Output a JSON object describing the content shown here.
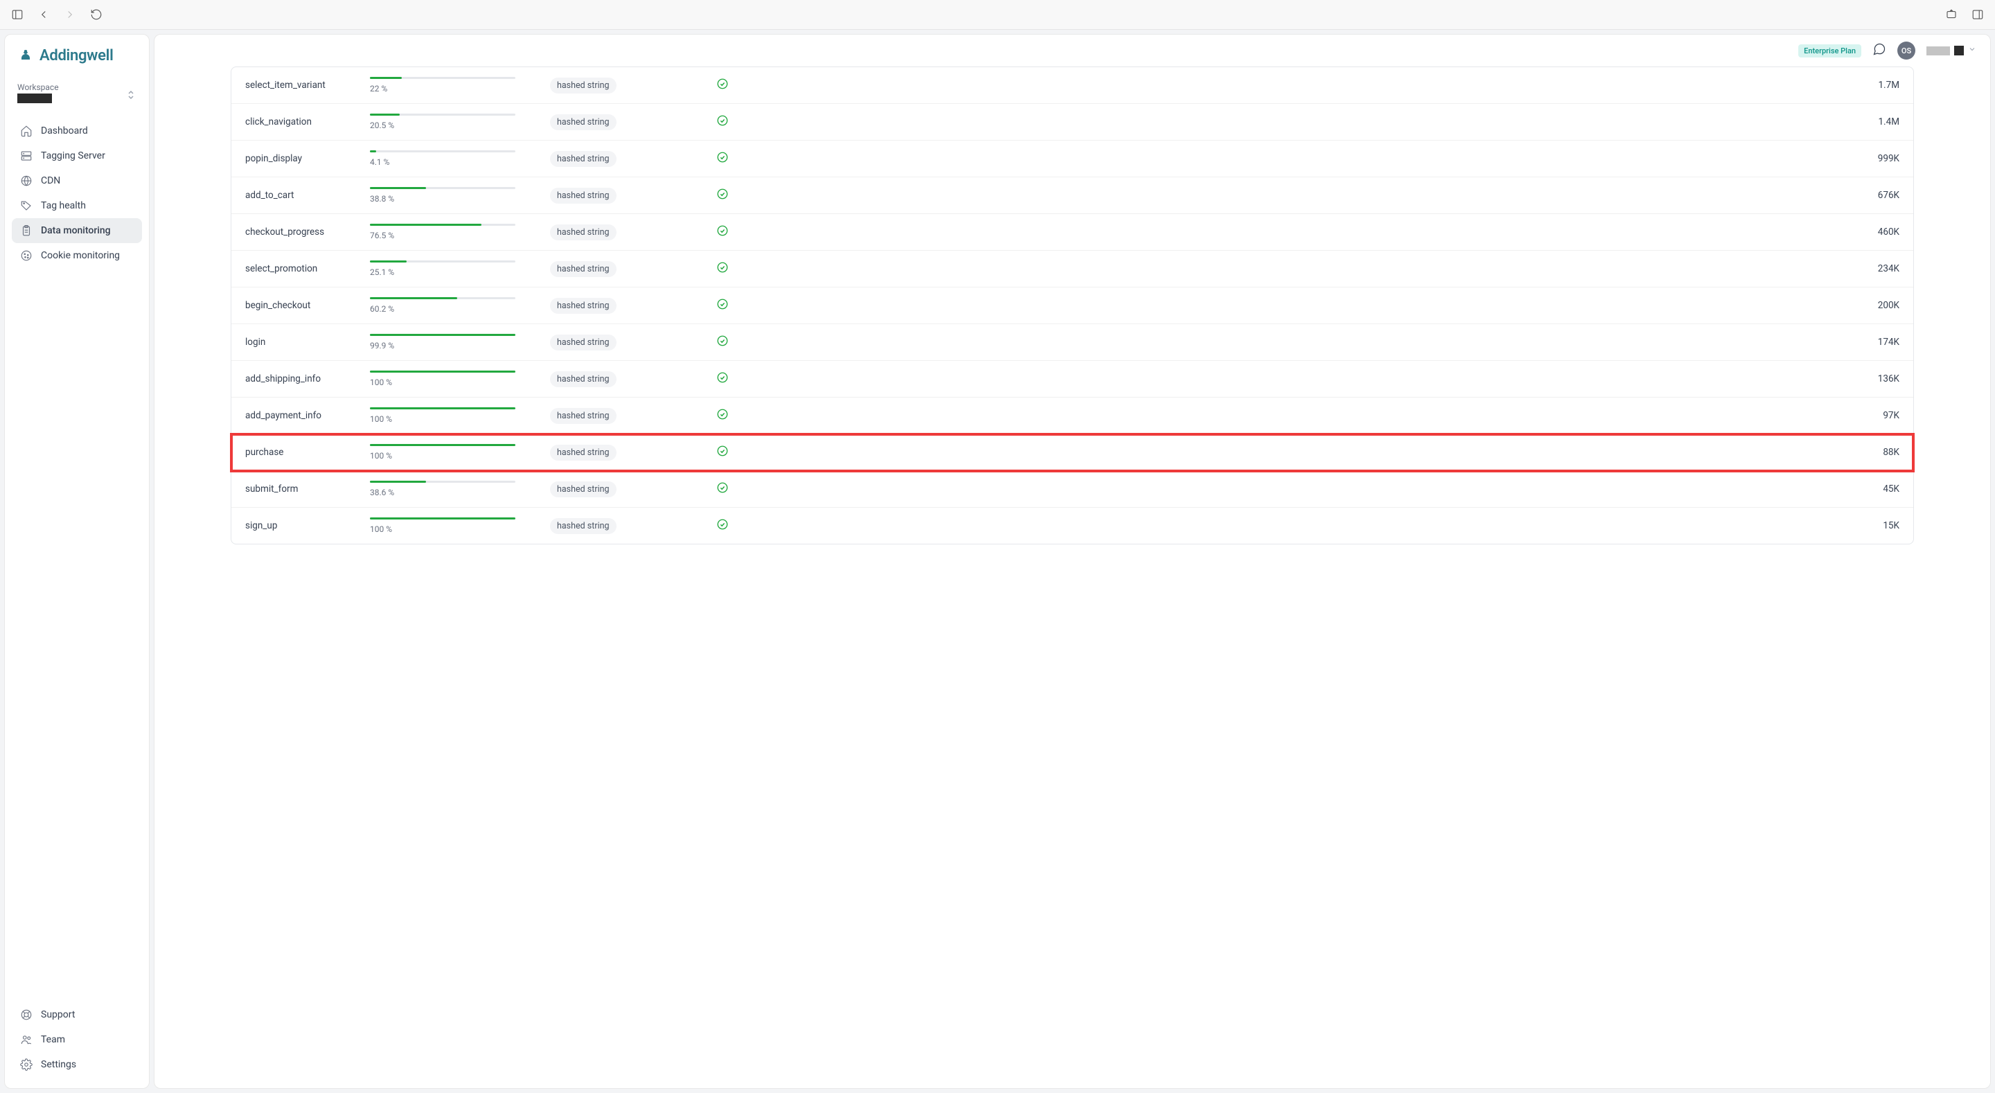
{
  "brand": "Addingwell",
  "workspace_label": "Workspace",
  "header": {
    "plan_badge": "Enterprise Plan",
    "avatar_initials": "OS"
  },
  "sidebar": {
    "items": [
      {
        "icon": "home",
        "label": "Dashboard"
      },
      {
        "icon": "server",
        "label": "Tagging Server"
      },
      {
        "icon": "globe",
        "label": "CDN"
      },
      {
        "icon": "tag",
        "label": "Tag health"
      },
      {
        "icon": "clipboard",
        "label": "Data monitoring"
      },
      {
        "icon": "cookie",
        "label": "Cookie monitoring"
      }
    ],
    "footer": [
      {
        "icon": "life-buoy",
        "label": "Support"
      },
      {
        "icon": "users",
        "label": "Team"
      },
      {
        "icon": "settings",
        "label": "Settings"
      }
    ]
  },
  "table": {
    "rows": [
      {
        "event": "select_item_variant",
        "percent": 22,
        "percent_label": "22 %",
        "type": "hashed string",
        "status": "ok",
        "count": "1.7M",
        "highlighted": false
      },
      {
        "event": "click_navigation",
        "percent": 20.5,
        "percent_label": "20.5 %",
        "type": "hashed string",
        "status": "ok",
        "count": "1.4M",
        "highlighted": false
      },
      {
        "event": "popin_display",
        "percent": 4.1,
        "percent_label": "4.1 %",
        "type": "hashed string",
        "status": "ok",
        "count": "999K",
        "highlighted": false
      },
      {
        "event": "add_to_cart",
        "percent": 38.8,
        "percent_label": "38.8 %",
        "type": "hashed string",
        "status": "ok",
        "count": "676K",
        "highlighted": false
      },
      {
        "event": "checkout_progress",
        "percent": 76.5,
        "percent_label": "76.5 %",
        "type": "hashed string",
        "status": "ok",
        "count": "460K",
        "highlighted": false
      },
      {
        "event": "select_promotion",
        "percent": 25.1,
        "percent_label": "25.1 %",
        "type": "hashed string",
        "status": "ok",
        "count": "234K",
        "highlighted": false
      },
      {
        "event": "begin_checkout",
        "percent": 60.2,
        "percent_label": "60.2 %",
        "type": "hashed string",
        "status": "ok",
        "count": "200K",
        "highlighted": false
      },
      {
        "event": "login",
        "percent": 99.9,
        "percent_label": "99.9 %",
        "type": "hashed string",
        "status": "ok",
        "count": "174K",
        "highlighted": false
      },
      {
        "event": "add_shipping_info",
        "percent": 100,
        "percent_label": "100 %",
        "type": "hashed string",
        "status": "ok",
        "count": "136K",
        "highlighted": false
      },
      {
        "event": "add_payment_info",
        "percent": 100,
        "percent_label": "100 %",
        "type": "hashed string",
        "status": "ok",
        "count": "97K",
        "highlighted": false
      },
      {
        "event": "purchase",
        "percent": 100,
        "percent_label": "100 %",
        "type": "hashed string",
        "status": "ok",
        "count": "88K",
        "highlighted": true
      },
      {
        "event": "submit_form",
        "percent": 38.6,
        "percent_label": "38.6 %",
        "type": "hashed string",
        "status": "ok",
        "count": "45K",
        "highlighted": false
      },
      {
        "event": "sign_up",
        "percent": 100,
        "percent_label": "100 %",
        "type": "hashed string",
        "status": "ok",
        "count": "15K",
        "highlighted": false
      }
    ]
  }
}
